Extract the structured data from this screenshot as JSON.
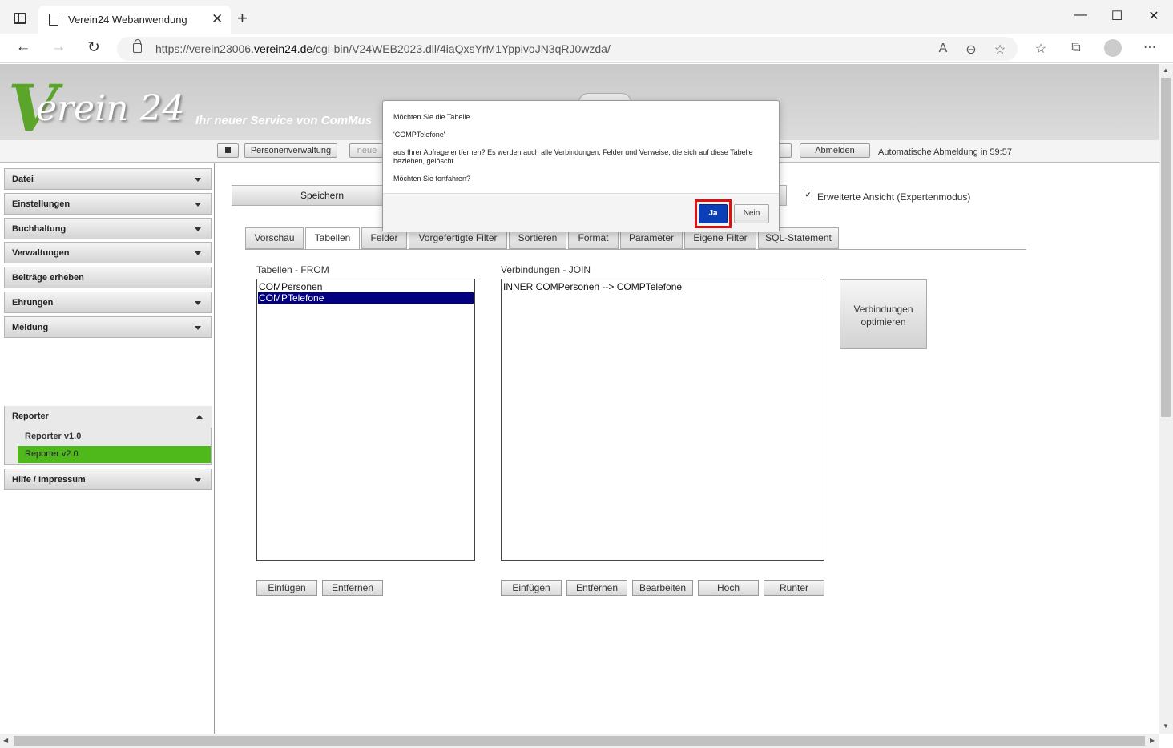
{
  "browser": {
    "tab_title": "Verein24 Webanwendung",
    "url_prefix": "https://verein23006.",
    "url_domain": "verein24.de",
    "url_path": "/cgi-bin/V24WEB2023.dll/4iaQxsYrM1YppivoJN3qRJ0wzda/"
  },
  "header": {
    "logo_v": "V",
    "logo_text": "erein 24",
    "tagline": "Ihr neuer Service von ComMus"
  },
  "toolbar": {
    "personenverwaltung": "Personenverwaltung",
    "neue": "neue",
    "abmelden": "Abmelden",
    "auto_logout": "Automatische Abmeldung in 59:57"
  },
  "sidebar": {
    "items": [
      {
        "label": "Datei"
      },
      {
        "label": "Einstellungen"
      },
      {
        "label": "Buchhaltung"
      },
      {
        "label": "Verwaltungen"
      },
      {
        "label": "Beiträge erheben"
      },
      {
        "label": "Ehrungen"
      },
      {
        "label": "Meldung"
      },
      {
        "label": "Reporter"
      },
      {
        "label": "Hilfe / Impressum"
      }
    ],
    "reporter_sub": [
      "Reporter v1.0",
      "Reporter v2.0"
    ]
  },
  "main": {
    "speichern": "Speichern",
    "expert_mode": "Erweiterte Ansicht (Expertenmodus)",
    "tabs": [
      "Vorschau",
      "Tabellen",
      "Felder",
      "Vorgefertigte Filter",
      "Sortieren",
      "Format",
      "Parameter",
      "Eigene Filter",
      "SQL-Statement"
    ],
    "active_tab": "Tabellen",
    "tables_label": "Tabellen - FROM",
    "tables": [
      "COMPersonen",
      "COMPTelefone"
    ],
    "selected_table": "COMPTelefone",
    "joins_label": "Verbindungen - JOIN",
    "joins": [
      "INNER COMPersonen --> COMPTelefone"
    ],
    "optimize_button": "Verbindungen optimieren",
    "tables_buttons": [
      "Einfügen",
      "Entfernen"
    ],
    "joins_buttons": [
      "Einfügen",
      "Entfernen",
      "Bearbeiten",
      "Hoch",
      "Runter"
    ]
  },
  "dialog": {
    "line1": "Möchten Sie die Tabelle",
    "line2": "'COMPTelefone'",
    "line3": "aus Ihrer Abfrage entfernen? Es werden auch alle Verbindungen, Felder und Verweise, die sich auf diese Tabelle beziehen, gelöscht.",
    "line4": "Möchten Sie fortfahren?",
    "ja": "Ja",
    "nein": "Nein"
  },
  "colors": {
    "active_sub_item": "#4fb81b",
    "selected_row": "#000080",
    "ja_button": "#0a3fb8",
    "highlight": "#e01010"
  }
}
